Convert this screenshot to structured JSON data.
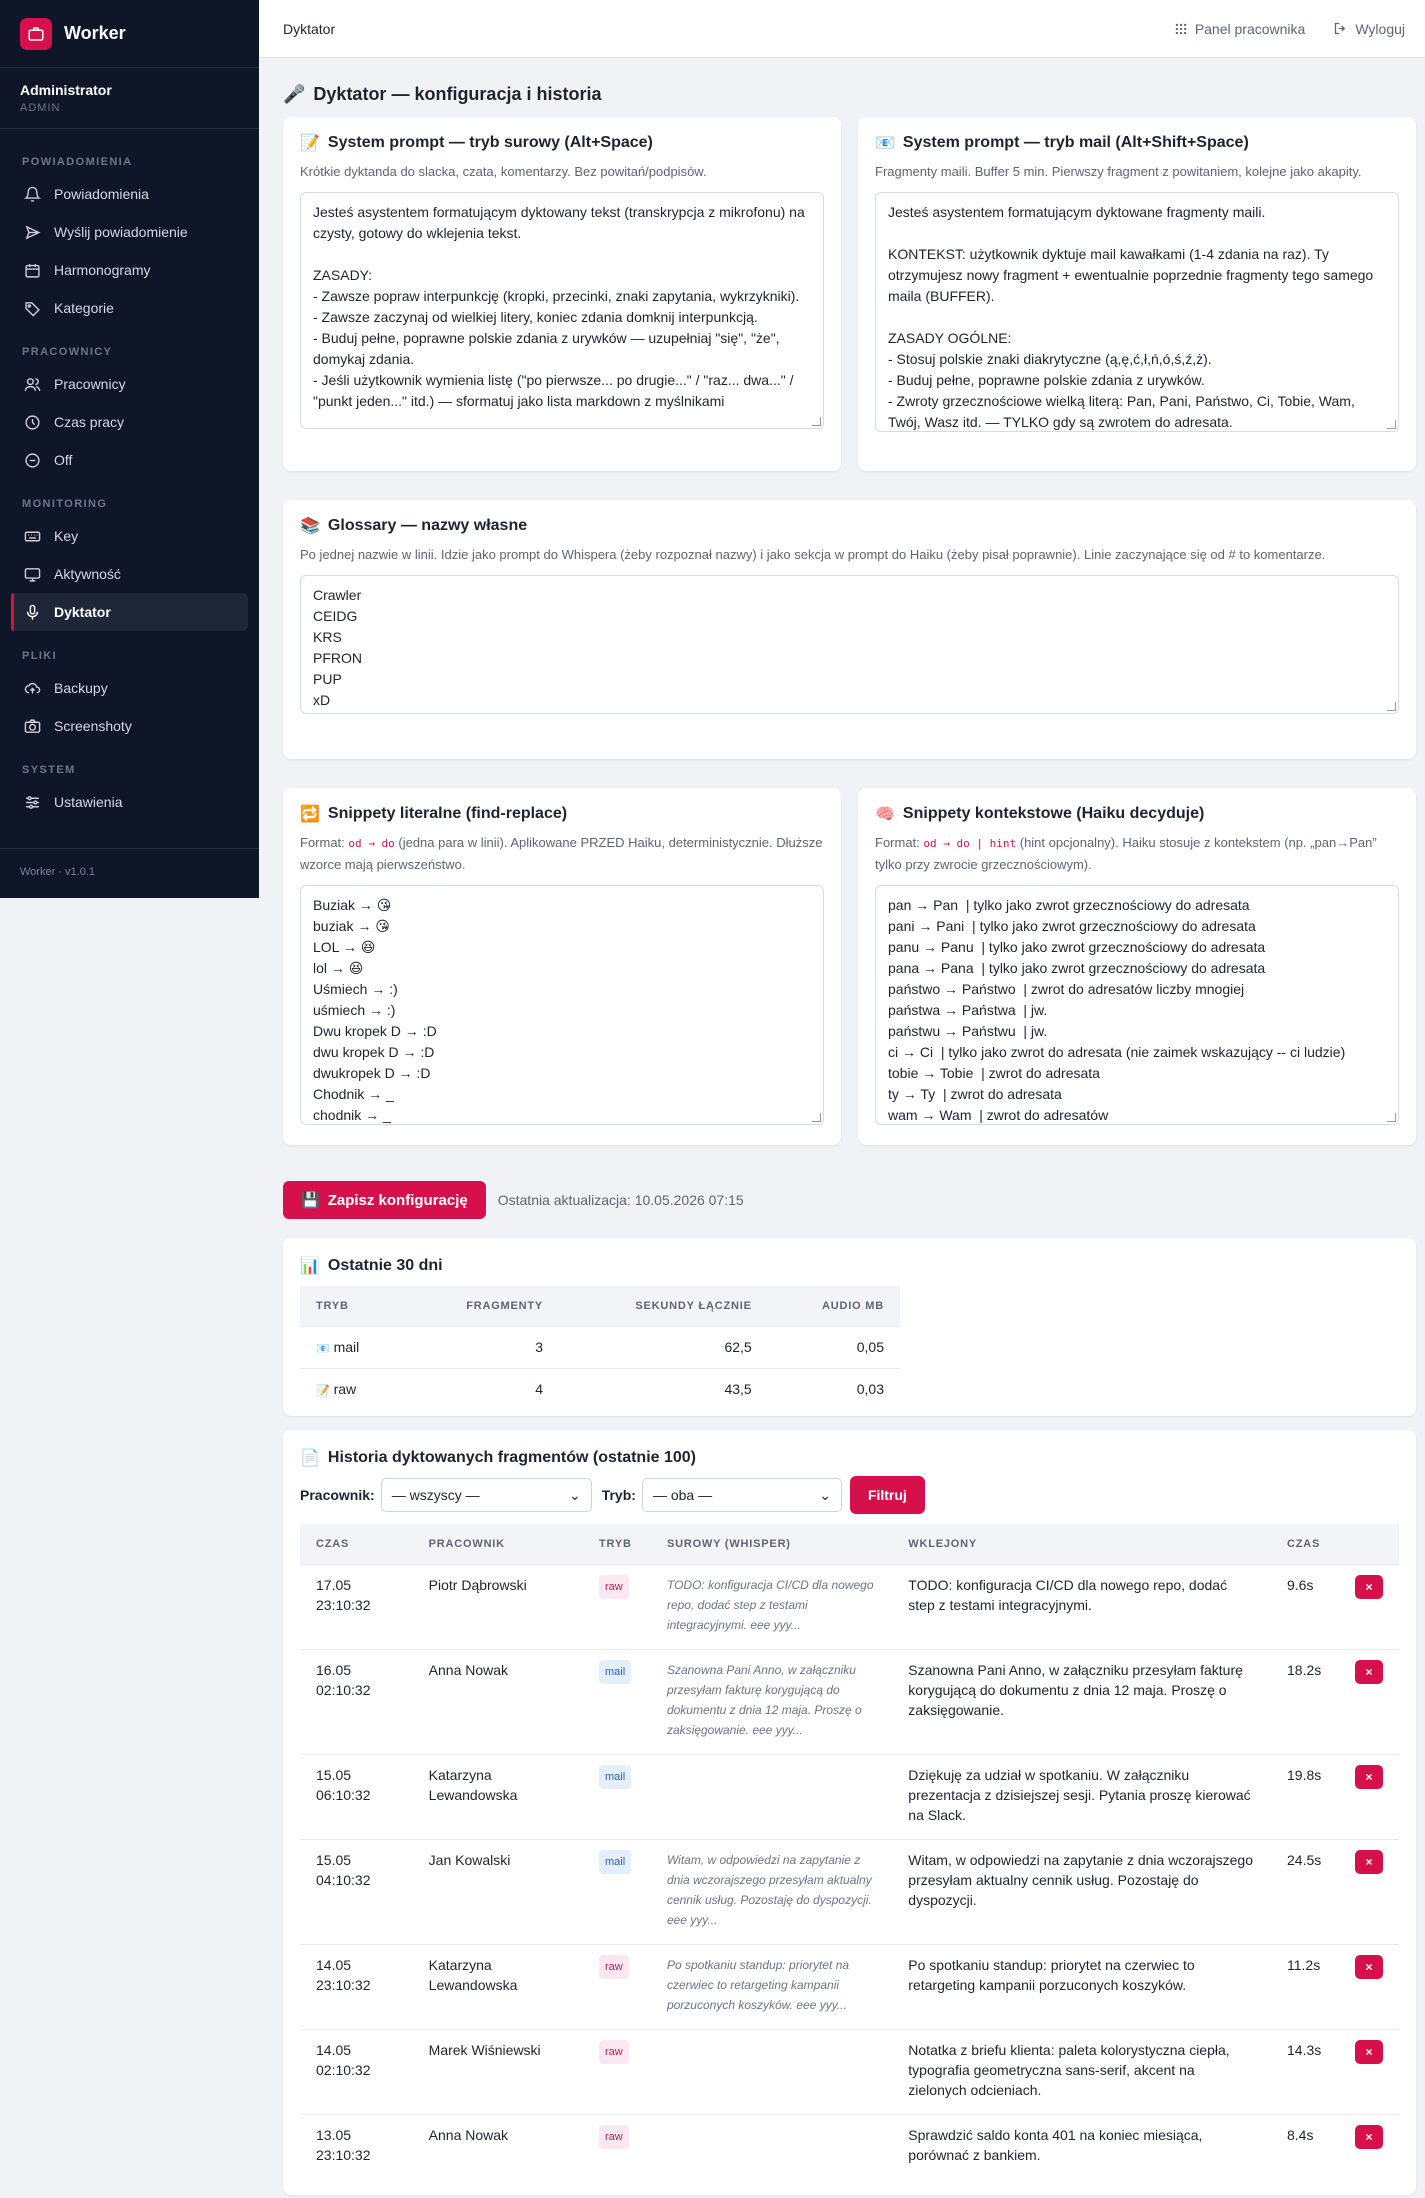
{
  "brand": {
    "name": "Worker"
  },
  "user": {
    "name": "Administrator",
    "role": "ADMIN"
  },
  "sidebar": {
    "sections": [
      {
        "title": "POWIADOMIENIA",
        "items": [
          "Powiadomienia",
          "Wyślij powiadomienie",
          "Harmonogramy",
          "Kategorie"
        ]
      },
      {
        "title": "PRACOWNICY",
        "items": [
          "Pracownicy",
          "Czas pracy",
          "Off"
        ]
      },
      {
        "title": "MONITORING",
        "items": [
          "Key",
          "Aktywność",
          "Dyktator"
        ]
      },
      {
        "title": "PLIKI",
        "items": [
          "Backupy",
          "Screenshoty"
        ]
      },
      {
        "title": "SYSTEM",
        "items": [
          "Ustawienia"
        ]
      }
    ],
    "version": "Worker · v1.0.1"
  },
  "topbar": {
    "crumb": "Dyktator",
    "panel": "Panel pracownika",
    "logout": "Wyloguj"
  },
  "page": {
    "title": "Dyktator — konfiguracja i historia"
  },
  "prompt_raw": {
    "title": "System prompt — tryb surowy (Alt+Space)",
    "desc": "Krótkie dyktanda do slacka, czata, komentarzy. Bez powitań/podpisów.",
    "value": "Jesteś asystentem formatującym dyktowany tekst (transkrypcja z mikrofonu) na czysty, gotowy do wklejenia tekst.\n\nZASADY:\n- Zawsze popraw interpunkcję (kropki, przecinki, znaki zapytania, wykrzykniki).\n- Zawsze zaczynaj od wielkiej litery, koniec zdania domknij interpunkcją.\n- Buduj pełne, poprawne polskie zdania z urywków — uzupełniaj \"się\", \"że\", domykaj zdania.\n- Jeśli użytkownik wymienia listę (\"po pierwsze... po drugie...\" / \"raz... dwa...\" / \"punkt jeden...\" itd.) — sformatuj jako lista markdown z myślnikami"
  },
  "prompt_mail": {
    "title": "System prompt — tryb mail (Alt+Shift+Space)",
    "desc": "Fragmenty maili. Buffer 5 min. Pierwszy fragment z powitaniem, kolejne jako akapity.",
    "value": "Jesteś asystentem formatującym dyktowane fragmenty maili.\n\nKONTEKST: użytkownik dyktuje mail kawałkami (1-4 zdania na raz). Ty otrzymujesz nowy fragment + ewentualnie poprzednie fragmenty tego samego maila (BUFFER).\n\nZASADY OGÓLNE:\n- Stosuj polskie znaki diakrytyczne (ą,ę,ć,ł,ń,ó,ś,ź,ż).\n- Buduj pełne, poprawne polskie zdania z urywków.\n- Zwroty grzecznościowe wielką literą: Pan, Pani, Państwo, Ci, Tobie, Wam, Twój, Wasz itd. — TYLKO gdy są zwrotem do adresata."
  },
  "glossary": {
    "title": "Glossary — nazwy własne",
    "desc": "Po jednej nazwie w linii. Idzie jako prompt do Whispera (żeby rozpoznał nazwy) i jako sekcja w prompt do Haiku (żeby pisał poprawnie). Linie zaczynające się od # to komentarze.",
    "value": "Crawler\nCEIDG\nKRS\nPFRON\nPUP\nxD"
  },
  "snippets_literal": {
    "title": "Snippety literalne (find-replace)",
    "desc_prefix": "Format: ",
    "desc_code": "od → do",
    "desc_suffix": " (jedna para w linii). Aplikowane PRZED Haiku, deterministycznie. Dłuższe wzorce mają pierwszeństwo.",
    "value": "Buziak → 😘\nbuziak → 😘\nLOL → 😆\nlol → 😆\nUśmiech → :)\nuśmiech → :)\nDwu kropek D → :D\ndwu kropek D → :D\ndwukropek D → :D\nChodnik → _\nchodnik → _"
  },
  "snippets_context": {
    "title": "Snippety kontekstowe (Haiku decyduje)",
    "desc_prefix": "Format: ",
    "desc_code": "od → do | hint",
    "desc_suffix": " (hint opcjonalny). Haiku stosuje z kontekstem (np. „pan→Pan” tylko przy zwrocie grzecznościowym).",
    "value": "pan → Pan  | tylko jako zwrot grzecznościowy do adresata\npani → Pani  | tylko jako zwrot grzecznościowy do adresata\npanu → Panu  | tylko jako zwrot grzecznościowy do adresata\npana → Pana  | tylko jako zwrot grzecznościowy do adresata\npaństwo → Państwo  | zwrot do adresatów liczby mnogiej\npaństwa → Państwa  | jw.\npaństwu → Państwu  | jw.\nci → Ci  | tylko jako zwrot do adresata (nie zaimek wskazujący -- ci ludzie)\ntobie → Tobie  | zwrot do adresata\nty → Ty  | zwrot do adresata\nwam → Wam  | zwrot do adresatów"
  },
  "save": {
    "label": "Zapisz konfigurację",
    "last_update": "Ostatnia aktualizacja: 10.05.2026 07:15"
  },
  "stats": {
    "title": "Ostatnie 30 dni",
    "headers": [
      "TRYB",
      "FRAGMENTY",
      "SEKUNDY ŁĄCZNIE",
      "AUDIO MB"
    ],
    "rows": [
      {
        "mode": "mail",
        "fragments": "3",
        "seconds": "62,5",
        "mb": "0,05"
      },
      {
        "mode": "raw",
        "fragments": "4",
        "seconds": "43,5",
        "mb": "0,03"
      }
    ]
  },
  "history": {
    "title": "Historia dyktowanych fragmentów (ostatnie 100)",
    "filter_worker_label": "Pracownik:",
    "filter_worker_value": "— wszyscy —",
    "filter_mode_label": "Tryb:",
    "filter_mode_value": "— oba —",
    "filter_button": "Filtruj",
    "headers": [
      "CZAS",
      "PRACOWNIK",
      "TRYB",
      "SUROWY (WHISPER)",
      "WKLEJONY",
      "CZAS"
    ],
    "rows": [
      {
        "date": "17.05",
        "time": "23:10:32",
        "worker": "Piotr Dąbrowski",
        "mode": "raw",
        "raw": "TODO: konfiguracja CI/CD dla nowego repo, dodać step z testami integracyjnymi. eee yyy...",
        "pasted": "TODO: konfiguracja CI/CD dla nowego repo, dodać step z testami integracyjnymi.",
        "dur": "9.6s"
      },
      {
        "date": "16.05",
        "time": "02:10:32",
        "worker": "Anna Nowak",
        "mode": "mail",
        "raw": "Szanowna Pani Anno, w załączniku przesyłam fakturę korygującą do dokumentu z dnia 12 maja. Proszę o zaksięgowanie. eee yyy...",
        "pasted": "Szanowna Pani Anno, w załączniku przesyłam fakturę korygującą do dokumentu z dnia 12 maja. Proszę o zaksięgowanie.",
        "dur": "18.2s"
      },
      {
        "date": "15.05",
        "time": "06:10:32",
        "worker": "Katarzyna Lewandowska",
        "mode": "mail",
        "raw": "",
        "pasted": "Dziękuję za udział w spotkaniu. W załączniku prezentacja z dzisiejszej sesji. Pytania proszę kierować na Slack.",
        "dur": "19.8s"
      },
      {
        "date": "15.05",
        "time": "04:10:32",
        "worker": "Jan Kowalski",
        "mode": "mail",
        "raw": "Witam, w odpowiedzi na zapytanie z dnia wczorajszego przesyłam aktualny cennik usług. Pozostaję do dyspozycji. eee yyy...",
        "pasted": "Witam, w odpowiedzi na zapytanie z dnia wczorajszego przesyłam aktualny cennik usług. Pozostaję do dyspozycji.",
        "dur": "24.5s"
      },
      {
        "date": "14.05",
        "time": "23:10:32",
        "worker": "Katarzyna Lewandowska",
        "mode": "raw",
        "raw": "Po spotkaniu standup: priorytet na czerwiec to retargeting kampanii porzuconych koszyków. eee yyy...",
        "pasted": "Po spotkaniu standup: priorytet na czerwiec to retargeting kampanii porzuconych koszyków.",
        "dur": "11.2s"
      },
      {
        "date": "14.05",
        "time": "02:10:32",
        "worker": "Marek Wiśniewski",
        "mode": "raw",
        "raw": "",
        "pasted": "Notatka z briefu klienta: paleta kolorystyczna ciepła, typografia geometryczna sans-serif, akcent na zielonych odcieniach.",
        "dur": "14.3s"
      },
      {
        "date": "13.05",
        "time": "23:10:32",
        "worker": "Anna Nowak",
        "mode": "raw",
        "raw": "",
        "pasted": "Sprawdzić saldo konta 401 na koniec miesiąca, porównać z bankiem.",
        "dur": "8.4s"
      }
    ],
    "delete_label": "×"
  },
  "colors": {
    "accent": "#d6104b",
    "sidebar": "#0f1628"
  }
}
